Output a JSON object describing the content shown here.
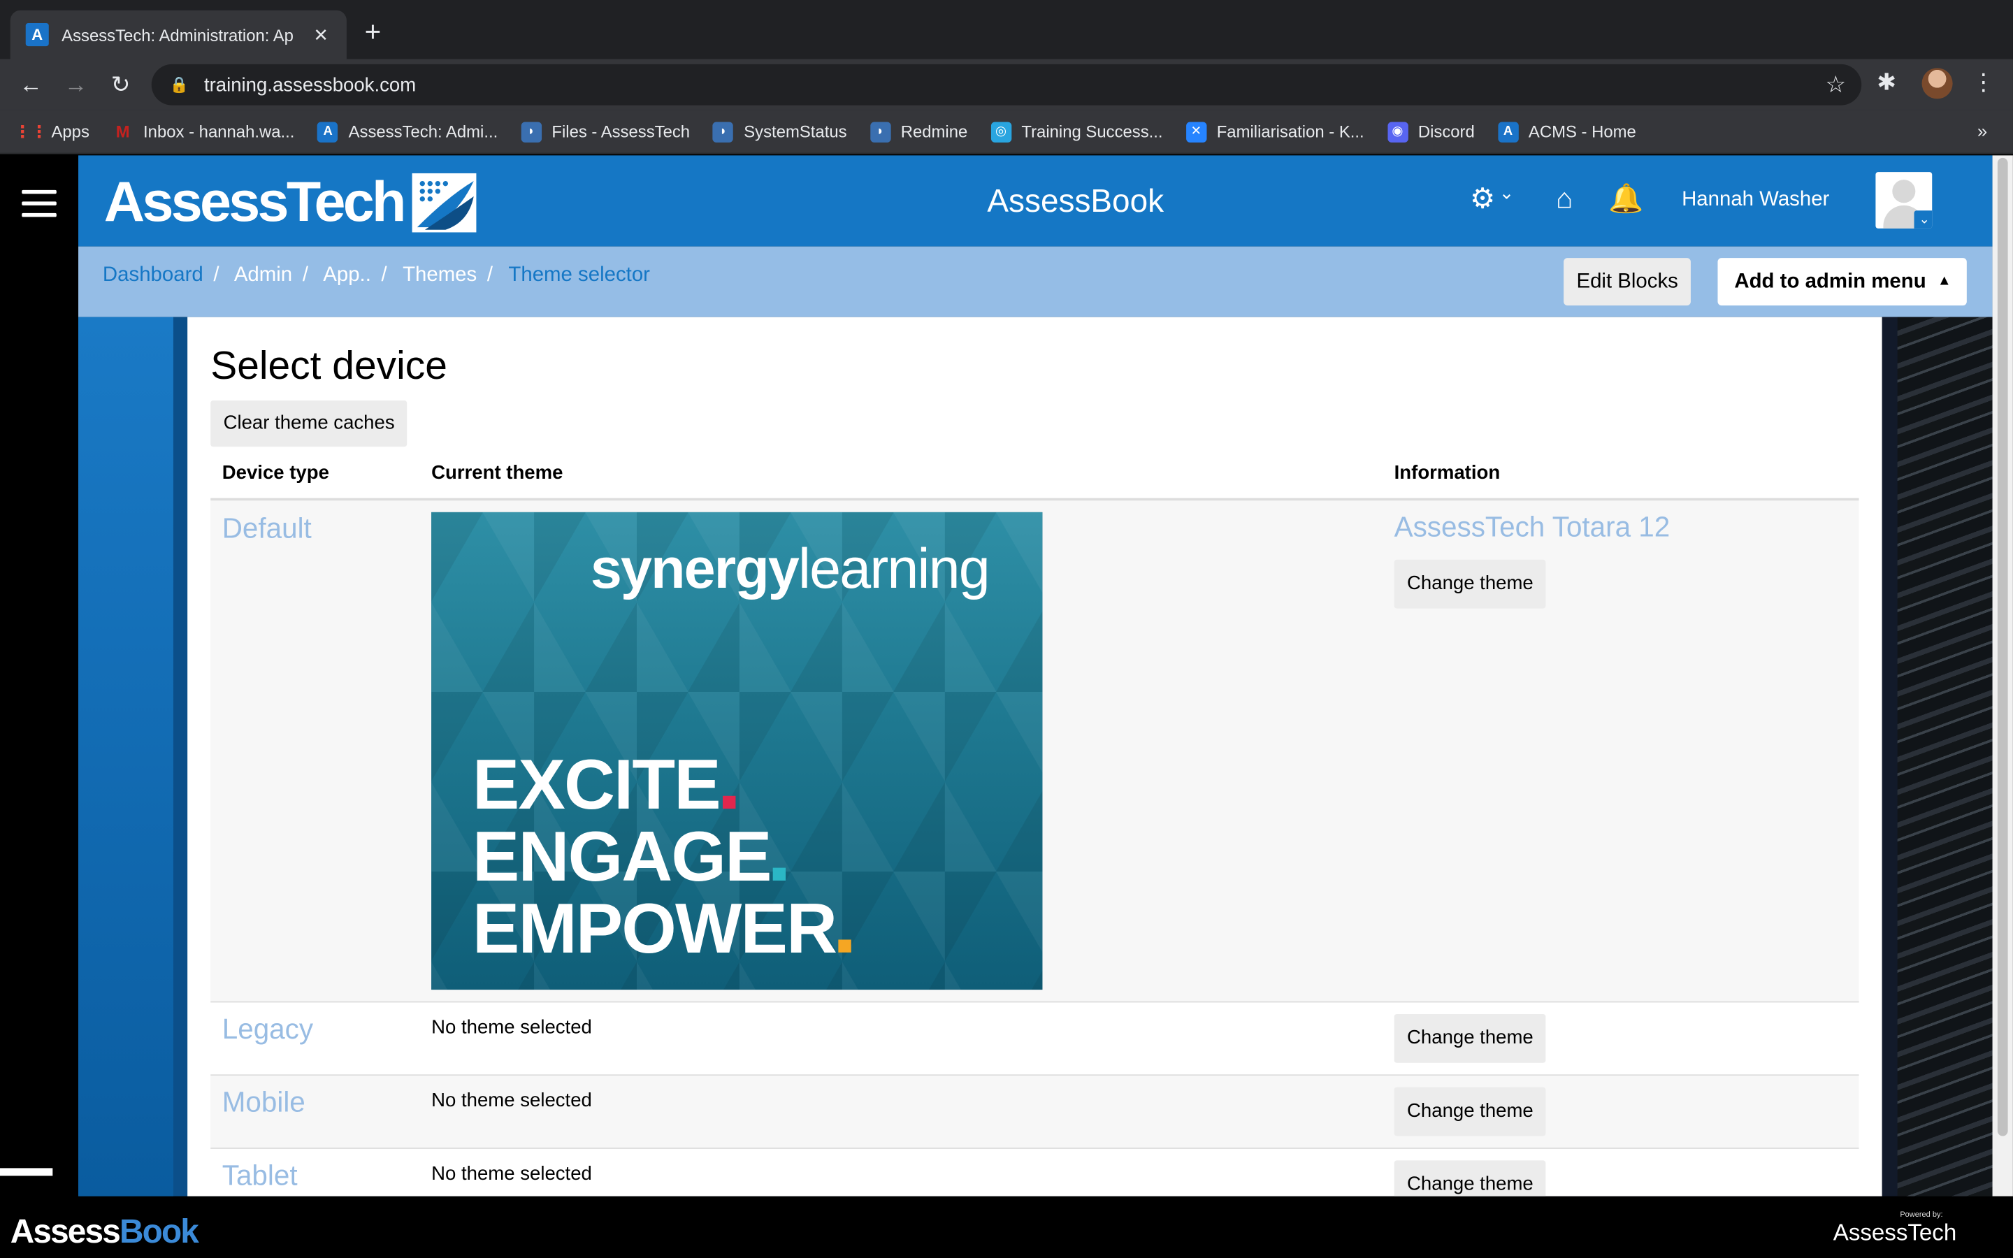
{
  "browser": {
    "tab_title": "AssessTech: Administration: Ap",
    "url": "training.assessbook.com",
    "bookmarks": [
      {
        "label": "Apps",
        "icon": "apps-grid-icon",
        "color": "#ea4335"
      },
      {
        "label": "Inbox - hannah.wa...",
        "icon": "gmail-icon",
        "color": "#c5221f"
      },
      {
        "label": "AssessTech: Admi...",
        "icon": "assesstech-icon",
        "color": "#1a73c8"
      },
      {
        "label": "Files - AssessTech",
        "icon": "files-icon",
        "color": "#1a73c8"
      },
      {
        "label": "SystemStatus",
        "icon": "systemstatus-icon",
        "color": "#1a73c8"
      },
      {
        "label": "Redmine",
        "icon": "redmine-icon",
        "color": "#1a73c8"
      },
      {
        "label": "Training Success...",
        "icon": "training-icon",
        "color": "#29a5e0"
      },
      {
        "label": "Familiarisation - K...",
        "icon": "confluence-icon",
        "color": "#2684ff"
      },
      {
        "label": "Discord",
        "icon": "discord-icon",
        "color": "#5865f2"
      },
      {
        "label": "ACMS - Home",
        "icon": "acms-icon",
        "color": "#1a73c8"
      }
    ],
    "more": "»"
  },
  "header": {
    "logo": "AssessTech",
    "site_name": "AssessBook",
    "user_name": "Hannah Washer"
  },
  "breadcrumb": {
    "items": [
      "Dashboard",
      "Admin",
      "App..",
      "Themes",
      "Theme selector"
    ]
  },
  "actions": {
    "edit_blocks": "Edit Blocks",
    "add_admin_menu": "Add to admin menu"
  },
  "main": {
    "title": "Select device",
    "clear_caches": "Clear theme caches",
    "columns": {
      "device": "Device type",
      "theme": "Current theme",
      "info": "Information"
    },
    "rows": [
      {
        "device": "Default",
        "theme": "",
        "info_name": "AssessTech Totara 12",
        "button": "Change theme"
      },
      {
        "device": "Legacy",
        "theme": "No theme selected",
        "button": "Change theme"
      },
      {
        "device": "Mobile",
        "theme": "No theme selected",
        "button": "Change theme"
      },
      {
        "device": "Tablet",
        "theme": "No theme selected",
        "button": "Change theme"
      }
    ],
    "screenshot": {
      "brand_a": "synergy",
      "brand_b": "learning",
      "line1": "EXCITE",
      "line2": "ENGAGE",
      "line3": "EMPOWER",
      "dot_colors": [
        "#e2264d",
        "#2bb7c6",
        "#f5a623"
      ]
    }
  },
  "footer": {
    "left_logo_a": "Assess",
    "left_logo_b": "Book",
    "right_logo": "AssessTech",
    "powered_by": "Powered by:"
  },
  "colors": {
    "brand_blue": "#1577c5",
    "crumb_bg": "#95bde6",
    "link_light": "#98bce3"
  }
}
